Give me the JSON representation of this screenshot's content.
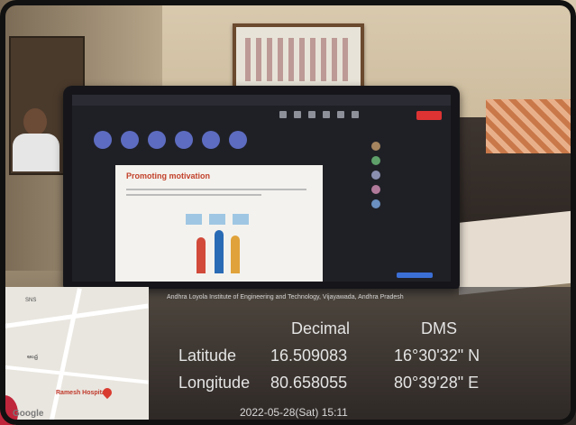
{
  "scene": {
    "meeting": {
      "slide_title": "Promoting motivation"
    }
  },
  "gps": {
    "map": {
      "label_top": "SNS",
      "label_mid": "ఆంధ్ర",
      "hospital": "Ramesh Hospitals",
      "brand": "Google"
    },
    "address": "Andhra Loyola Institute of Engineering and Technology, Vijayawada, Andhra Pradesh",
    "columns": {
      "decimal": "Decimal",
      "dms": "DMS"
    },
    "rows": [
      {
        "label": "Latitude",
        "decimal": "16.509083",
        "dms": "16°30'32\" N"
      },
      {
        "label": "Longitude",
        "decimal": "80.658055",
        "dms": "80°39'28\" E"
      }
    ],
    "datetime": "2022-05-28(Sat)  15:11"
  }
}
